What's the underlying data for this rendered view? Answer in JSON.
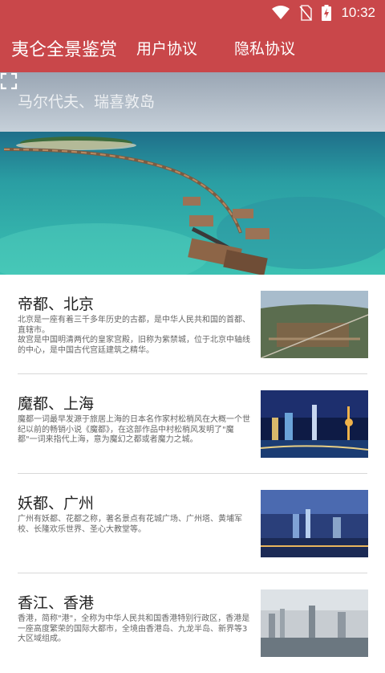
{
  "status_bar": {
    "time": "10:32",
    "icons": [
      "wifi-icon",
      "no-sim-icon",
      "battery-charging-icon"
    ]
  },
  "app_bar": {
    "title": "夷仑全景鉴赏",
    "user_agreement": "用户协议",
    "privacy_policy": "隐私协议"
  },
  "hero": {
    "caption": "马尔代夫、瑞喜敦岛",
    "fullscreen_icon": "fullscreen-icon"
  },
  "items": [
    {
      "title": "帝都、北京",
      "desc": "北京是一座有着三千多年历史的古都，是中华人民共和国的首都、直辖市。\n故宫是中国明清两代的皇家宫殿，旧称为紫禁城，位于北京中轴线的中心，是中国古代宫廷建筑之精华。"
    },
    {
      "title": "魔都、上海",
      "desc": "魔都一词最早发源于旅居上海的日本名作家村松梢风在大概一个世纪以前的畅销小说《魔都》，在这部作品中村松梢风发明了\"魔都\"一词来指代上海，意为魔幻之都或者魔力之城。"
    },
    {
      "title": "妖都、广州",
      "desc": "广州有妖都、花都之称，著名景点有花城广场、广州塔、黄埔军校、长隆欢乐世界、圣心大教堂等。"
    },
    {
      "title": "香江、香港",
      "desc": "香港，简称\"港\"，全称为中华人民共和国香港特别行政区，香港是一座高度繁荣的国际大都市，全境由香港岛、九龙半岛、新界等3大区域组成。"
    }
  ],
  "colors": {
    "primary": "#c9474a",
    "divider": "#d8d8d8",
    "title_text": "#222222",
    "desc_text": "#666666"
  }
}
